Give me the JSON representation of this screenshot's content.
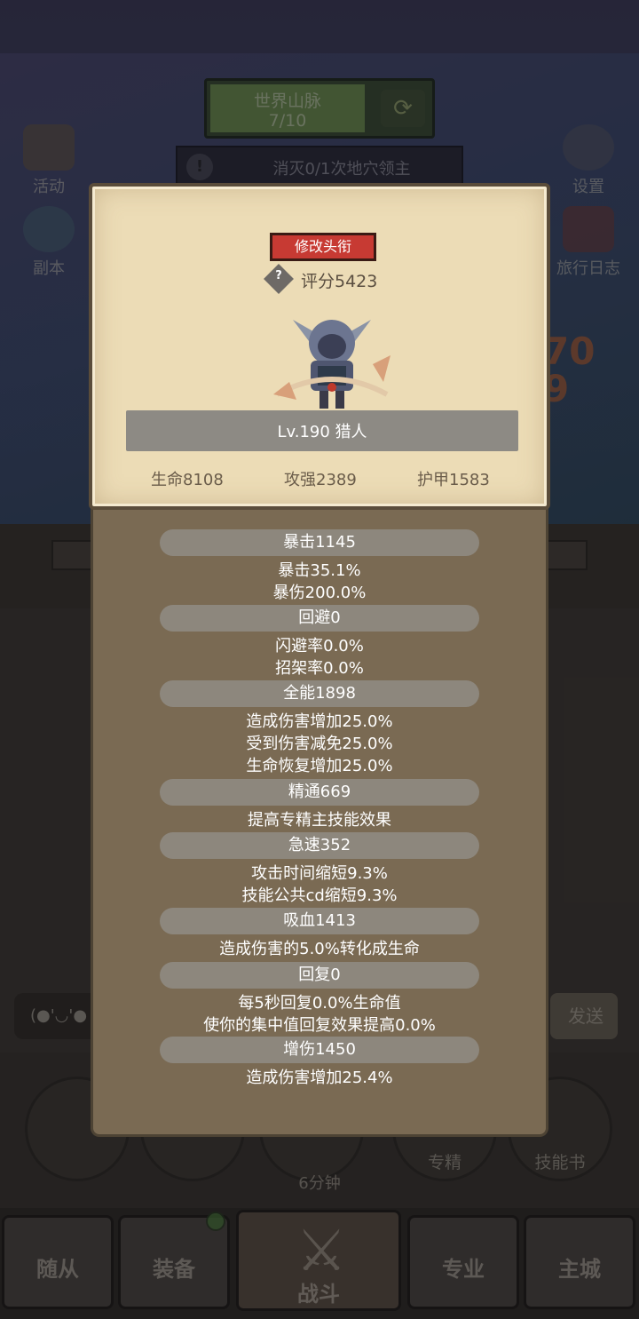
{
  "background": {
    "stage": {
      "name": "世界山脉",
      "progress": "7/10"
    },
    "quest": {
      "text": "消灭0/1次地穴领主"
    },
    "left_buttons": [
      {
        "label": "活动",
        "icon": "calendar-icon"
      },
      {
        "label": "副本",
        "icon": "dungeon-portal-icon"
      }
    ],
    "right_buttons": [
      {
        "label": "设置",
        "icon": "gear-icon"
      },
      {
        "label": "旅行日志",
        "icon": "book-icon"
      }
    ],
    "score_deco": "70\n9",
    "chat_placeholder": "(●'◡'●",
    "send_label": "发送",
    "circle_buttons": [
      {
        "label": ""
      },
      {
        "label": ""
      },
      {
        "label": ""
      },
      {
        "label": "专精"
      },
      {
        "label": "技能书"
      }
    ],
    "timer": "6分钟",
    "nav": {
      "followers": "随从",
      "equipment": "装备",
      "battle": "战斗",
      "profession": "专业",
      "main_city": "主城"
    }
  },
  "popup": {
    "title_button": "修改头衔",
    "score_label": "评分5423",
    "hero_name": "Lv.190 猎人",
    "stats": {
      "hp": "生命8108",
      "attack": "攻强2389",
      "armor": "护甲1583"
    },
    "attributes": [
      {
        "header": "暴击1145",
        "lines": [
          "暴击35.1%",
          "暴伤200.0%"
        ]
      },
      {
        "header": "回避0",
        "lines": [
          "闪避率0.0%",
          "招架率0.0%"
        ]
      },
      {
        "header": "全能1898",
        "lines": [
          "造成伤害增加25.0%",
          "受到伤害减免25.0%",
          "生命恢复增加25.0%"
        ]
      },
      {
        "header": "精通669",
        "lines": [
          "提高专精主技能效果"
        ]
      },
      {
        "header": "急速352",
        "lines": [
          "攻击时间缩短9.3%",
          "技能公共cd缩短9.3%"
        ]
      },
      {
        "header": "吸血1413",
        "lines": [
          "造成伤害的5.0%转化成生命"
        ]
      },
      {
        "header": "回复0",
        "lines": [
          "每5秒回复0.0%生命值",
          "使你的集中值回复效果提高0.0%"
        ]
      },
      {
        "header": "增伤1450",
        "lines": [
          "造成伤害增加25.4%"
        ]
      }
    ]
  },
  "colors": {
    "title_button": "#c73a33",
    "card": "#ecdcb6",
    "panel": "#7a6a53",
    "attr_pill": "#8d877d"
  }
}
